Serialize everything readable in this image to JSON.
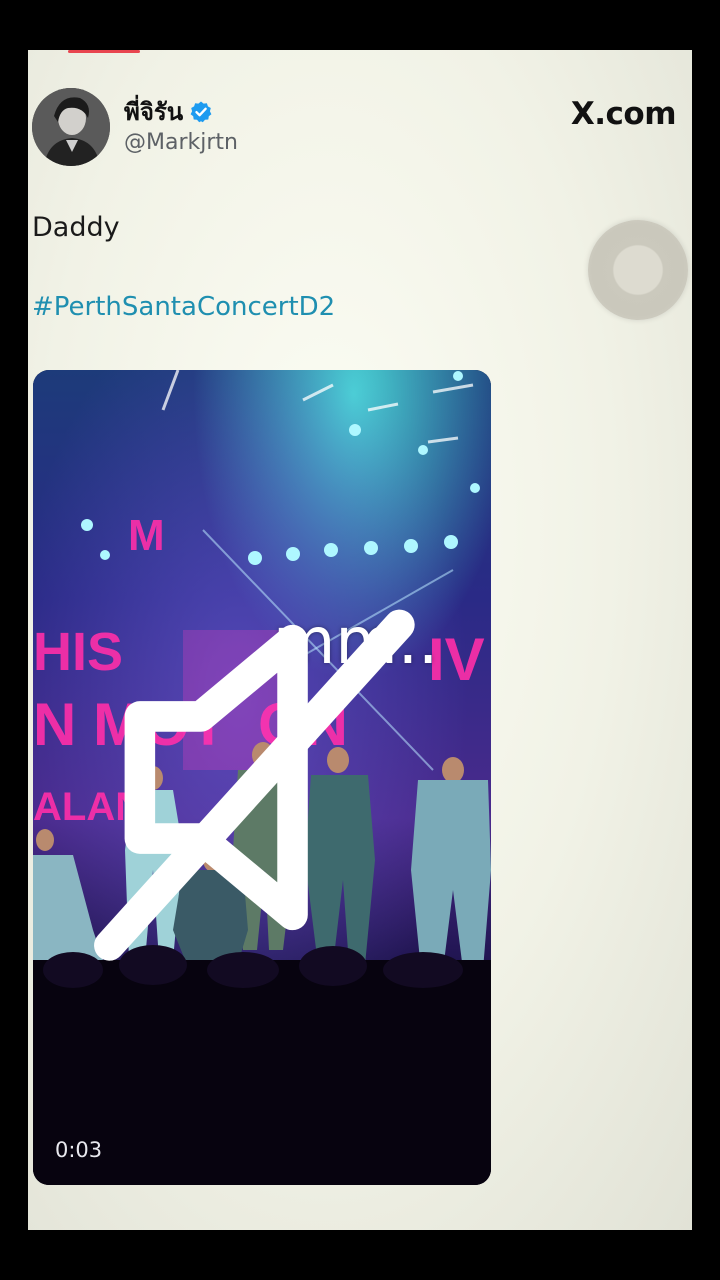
{
  "tweet": {
    "display_name": "พี่จิรัน",
    "handle": "@Markjrtn",
    "site": "X.com",
    "text": "Daddy",
    "hashtag": "#PerthSantaConcertD2"
  },
  "video": {
    "caption": "mm..",
    "duration": "0:03",
    "muted": true
  },
  "icons": [
    "verified-badge-icon",
    "mute-icon"
  ],
  "colors": {
    "hashtag": "#1f8fb0",
    "verified": "#1d9bf0",
    "background": "#f1f2e6"
  }
}
